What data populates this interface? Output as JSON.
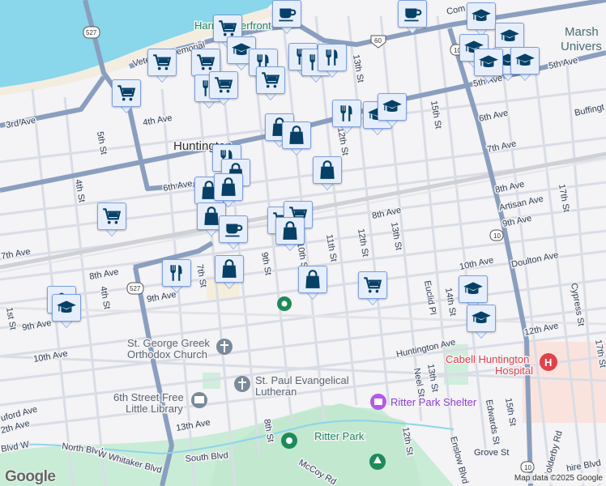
{
  "map": {
    "labels": {
      "harris_waterfront": "Harris Riverfront",
      "veterans_memorial": "Veterans Memorial",
      "third_ave": "3rd Ave",
      "fourth_ave": "4th Ave",
      "fifth_st": "5th St",
      "fourth_st": "4th St",
      "huntington": "Huntington",
      "sixth_ave": "6th Ave",
      "seventh_ave_w": "7th Ave",
      "eighth_ave_w": "8th Ave",
      "ninth_ave_w": "9th Ave",
      "ninth_ave_w2": "9th Ave",
      "seventh_st": "7th St",
      "fourth_st_s": "4th St",
      "first_st": "1st St",
      "tenth_ave_w": "10th Ave",
      "ninth_st": "9th St",
      "eighth_st": "8th St",
      "thirteenth_ave": "13th Ave",
      "north_blvd": "North Blvd",
      "w_whitaker": "W Whitaker Blvd",
      "south_blvd": "South Blvd",
      "mccoy": "McCoy Rd",
      "blvd_w": "Blvd W",
      "guilford": "uford Ave",
      "twelfth_ave_w": "2th Ave",
      "thirteenth_st": "13th St",
      "twelfth_st": "12th St",
      "fifteenth_st": "15th St",
      "fifth_ave_e": "5th Ave",
      "fifth_ave_e2": "5th Ave",
      "sixth_ave_e": "6th Ave",
      "seventh_ave_e": "7th Ave",
      "eighth_ave_e": "8th Ave",
      "eighth_ave_c": "8th Ave",
      "artisan": "Artisan Ave",
      "ninth_ave_e": "9th Ave",
      "seventeenth_st": "17th St",
      "buffington": "Buffingt",
      "commerce": "Com",
      "marshall": "Marsh",
      "university": "Univers",
      "eleventh_st": "11th St",
      "twelfth_st_c": "12th St",
      "thirteenth_st_c": "13th St",
      "tenth_ave_e": "10th Ave",
      "doulton": "Doulton Ave",
      "euclid": "Euclid Pl",
      "fourteenth_st": "14th St",
      "cypress": "Cypress St",
      "twelfth_ave_e": "12th Ave",
      "huntington_ave": "Huntington Ave",
      "neel": "Neel St",
      "thirteenth_st_s": "13th St",
      "twelfth_st_s": "12th St",
      "enslow": "Enslow Blvd",
      "edwards": "Edwards St",
      "fifteenth_st_s": "15th St",
      "grove": "Grove St",
      "holderby": "Holderby Rd",
      "seventeenth_st_s": "17th St",
      "wiltshire": "hire Blvd",
      "shield_527": "527",
      "shield_527b": "527",
      "shield_60": "60",
      "shield_10": "10",
      "shield_10b": "10",
      "shield_10c": "10",
      "st_george_1": "St. George Greek",
      "st_george_2": "Orthodox Church",
      "st_paul_1": "St. Paul Evangelical",
      "st_paul_2": "Lutheran",
      "library_1": "6th Street Free",
      "library_2": "Little Library",
      "ritter_shelter": "Ritter Park Shelter",
      "ritter_park": "Ritter Park",
      "cabell_1": "Cabell Huntington",
      "cabell_2": "Hospital",
      "tenth_st": "10th St"
    },
    "markers": [
      "cart",
      "coffee",
      "cart",
      "cart",
      "cart",
      "school",
      "fork",
      "cart",
      "fork",
      "cart",
      "fork",
      "fork",
      "fork",
      "coffee",
      "school",
      "school",
      "school",
      "school",
      "school",
      "school",
      "fork",
      "school",
      "school",
      "bag",
      "bag",
      "bag",
      "fork",
      "bag",
      "bag",
      "bag",
      "cart",
      "bag",
      "coffee",
      "cart",
      "cart",
      "bag",
      "fork",
      "bag",
      "bag",
      "cart",
      "school",
      "school",
      "school",
      "school"
    ],
    "colors": {
      "water": "#8ad6ea",
      "park": "#c9ecd6",
      "major_road": "#8a9fbf",
      "marker_icon": "#064066",
      "marker_bg": "#e6eefc"
    }
  },
  "branding": {
    "logo": "Google",
    "attribution": "Map data ©2025 Google"
  }
}
